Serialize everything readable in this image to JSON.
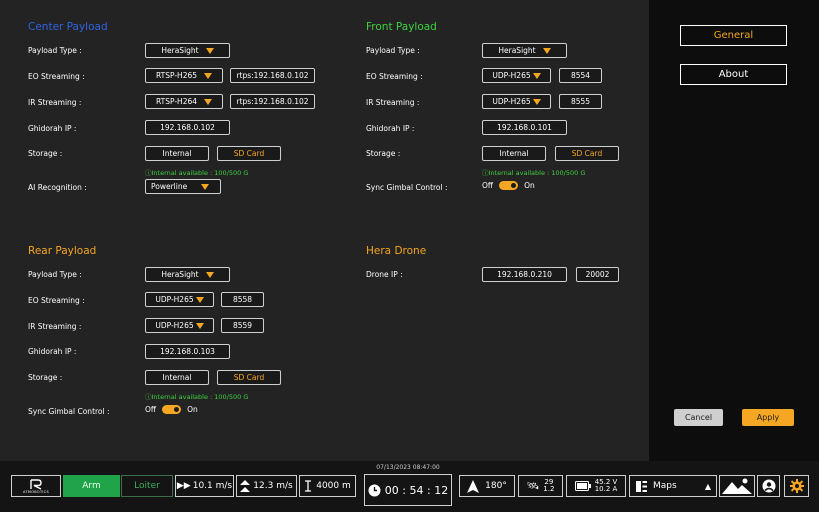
{
  "center": {
    "title": "Center Payload",
    "payload_type_label": "Payload Type :",
    "payload_type_value": "HeraSight",
    "eo_label": "EO Streaming :",
    "eo_protocol": "RTSP-H265",
    "eo_address": "rtps:192.168.0.102",
    "ir_label": "IR Streaming :",
    "ir_protocol": "RTSP-H264",
    "ir_address": "rtps:192.168.0.102",
    "ip_label": "Ghidorah IP :",
    "ip_value": "192.168.0.102",
    "storage_label": "Storage :",
    "storage_internal": "Internal",
    "storage_sd": "SD Card",
    "storage_avail": "Internal available : 100/500 G",
    "ai_label": "AI Recognition :",
    "ai_value": "Powerline"
  },
  "front": {
    "title": "Front Payload",
    "payload_type_label": "Payload Type :",
    "payload_type_value": "HeraSight",
    "eo_label": "EO Streaming :",
    "eo_protocol": "UDP-H265",
    "eo_port": "8554",
    "ir_label": "IR Streaming :",
    "ir_protocol": "UDP-H265",
    "ir_port": "8555",
    "ip_label": "Ghidorah IP :",
    "ip_value": "192.168.0.101",
    "storage_label": "Storage :",
    "storage_internal": "Internal",
    "storage_sd": "SD Card",
    "storage_avail": "Internal available : 100/500 G",
    "sync_label": "Sync Gimbal Control :",
    "sync_off": "Off",
    "sync_on": "On"
  },
  "rear": {
    "title": "Rear Payload",
    "payload_type_label": "Payload Type :",
    "payload_type_value": "HeraSight",
    "eo_label": "EO Streaming :",
    "eo_protocol": "UDP-H265",
    "eo_port": "8558",
    "ir_label": "IR Streaming :",
    "ir_protocol": "UDP-H265",
    "ir_port": "8559",
    "ip_label": "Ghidorah IP :",
    "ip_value": "192.168.0.103",
    "storage_label": "Storage :",
    "storage_internal": "Internal",
    "storage_sd": "SD Card",
    "storage_avail": "Internal available : 100/500 G",
    "sync_label": "Sync Gimbal Control :",
    "sync_off": "Off",
    "sync_on": "On"
  },
  "drone": {
    "title": "Hera Drone",
    "ip_label": "Drone IP :",
    "ip_value": "192.168.0.210",
    "port_value": "20002"
  },
  "menu": {
    "general": "General",
    "about": "About",
    "cancel": "Cancel",
    "apply": "Apply"
  },
  "bottombar": {
    "logo_text": "ATMOBOTICS",
    "arm": "Arm",
    "loiter": "Loiter",
    "speed_h": "10.1 m/s",
    "speed_v": "12.3 m/s",
    "altitude": "4000 m",
    "date": "07/13/2023 08:47:00",
    "timer": "00 : 54 : 12",
    "heading": "180°",
    "sat_top": "29",
    "sat_bottom": "1.2",
    "voltage": "45.2 V",
    "current": "10.2 A",
    "maps": "Maps"
  },
  "colors": {
    "accent": "#f5a623",
    "center_title": "#2f63e3",
    "front_title": "#3fd13f",
    "arm": "#1fa44a"
  }
}
